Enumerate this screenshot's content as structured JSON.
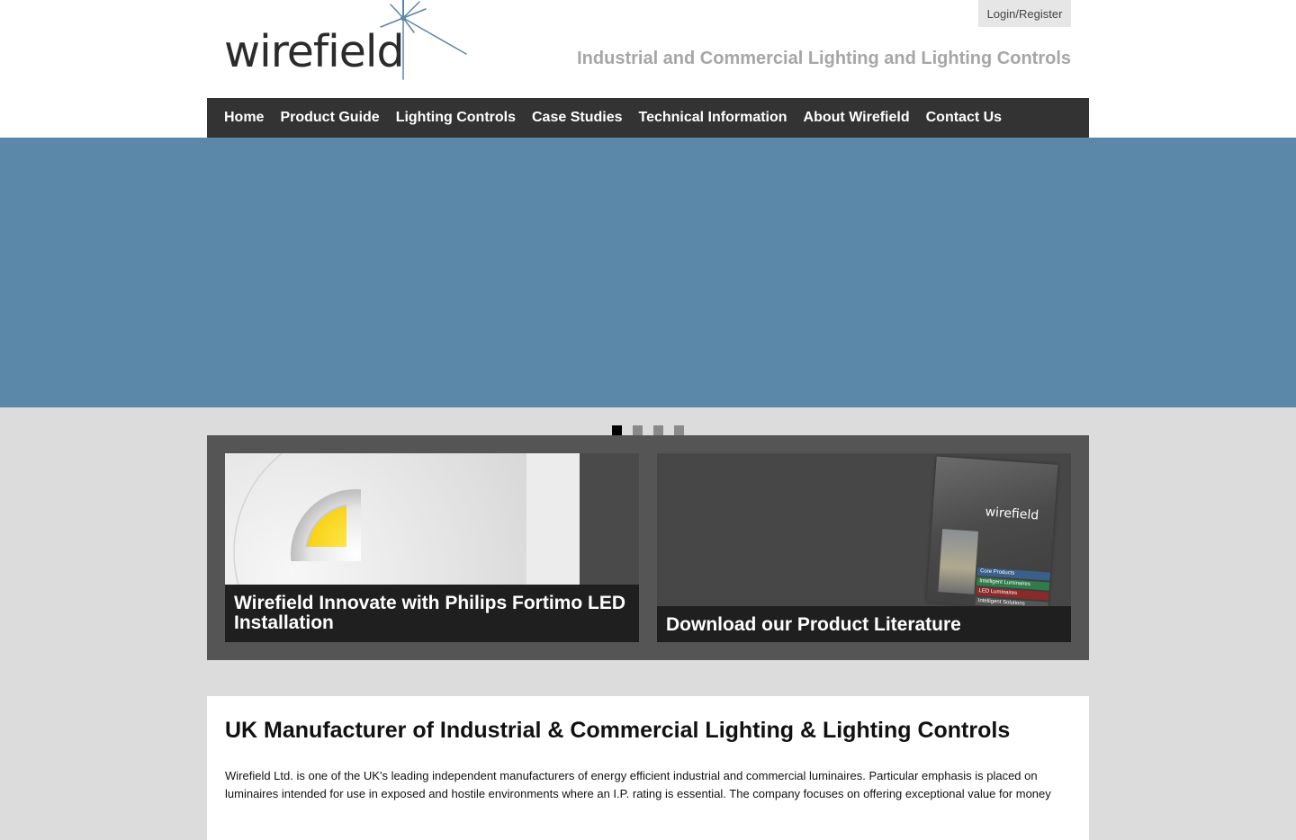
{
  "header": {
    "logo_text": "wirefield",
    "login_label": "Login/Register",
    "tagline": "Industrial and Commercial Lighting and Lighting Controls"
  },
  "nav": {
    "items": [
      {
        "label": "Home"
      },
      {
        "label": "Product Guide"
      },
      {
        "label": "Lighting Controls"
      },
      {
        "label": "Case Studies"
      },
      {
        "label": "Technical Information"
      },
      {
        "label": "About Wirefield"
      },
      {
        "label": "Contact Us"
      }
    ]
  },
  "slider": {
    "active_index": 0,
    "slide_count": 4
  },
  "features": {
    "left_caption": "Wirefield Innovate with Philips Fortimo LED Installation",
    "right_caption": "Download our Product Literature",
    "brochure": {
      "brand": "wirefield",
      "lines": [
        "Core Products",
        "Intelligent Luminaires",
        "LED Luminaires",
        "Intelligent Solutions"
      ]
    }
  },
  "content": {
    "heading": "UK Manufacturer of Industrial & Commercial Lighting & Lighting Controls",
    "body": "Wirefield Ltd. is one of the UK's leading independent manufacturers of energy efficient industrial and commercial luminaires. Particular emphasis is placed on luminaires intended for use in exposed and hostile environments where an I.P. rating is essential. The company focuses on offering exceptional value for money"
  },
  "colors": {
    "nav_bg": "#333333",
    "hero_bg": "#5b87a8",
    "page_bg": "#dcdcdc",
    "tagline": "#a6a6a6"
  }
}
